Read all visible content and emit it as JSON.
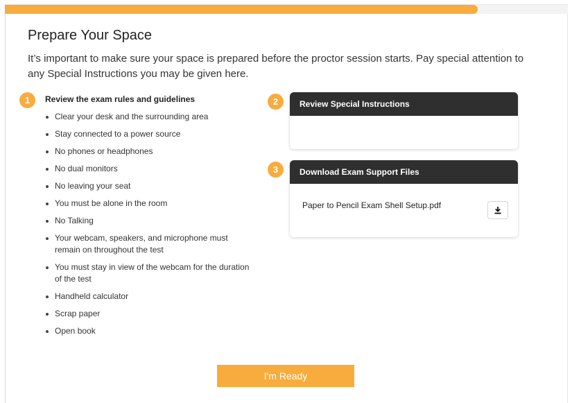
{
  "progress": {
    "percent": 84
  },
  "header": {
    "title": "Prepare Your Space",
    "intro": "It’s important to make sure your space is prepared before the proctor session starts. Pay special attention to any Special Instructions you may be given here."
  },
  "steps": {
    "rules": {
      "number": "1",
      "heading": "Review the exam rules and guidelines",
      "items": [
        "Clear your desk and the surrounding area",
        "Stay connected to a power source",
        "No phones or headphones",
        "No dual monitors",
        "No leaving your seat",
        "You must be alone in the room",
        "No Talking",
        "Your webcam, speakers, and microphone must remain on throughout the test",
        "You must stay in view of the webcam for the duration of the test",
        "Handheld calculator",
        "Scrap paper",
        "Open book"
      ]
    },
    "instructions": {
      "number": "2",
      "heading": "Review Special Instructions"
    },
    "files": {
      "number": "3",
      "heading": "Download Exam Support Files",
      "file_name": "Paper to Pencil Exam Shell Setup.pdf",
      "download_icon": "download-icon"
    }
  },
  "actions": {
    "ready_label": "I'm Ready"
  },
  "colors": {
    "accent": "#f8ac3d",
    "card_header": "#2f2f2f"
  }
}
